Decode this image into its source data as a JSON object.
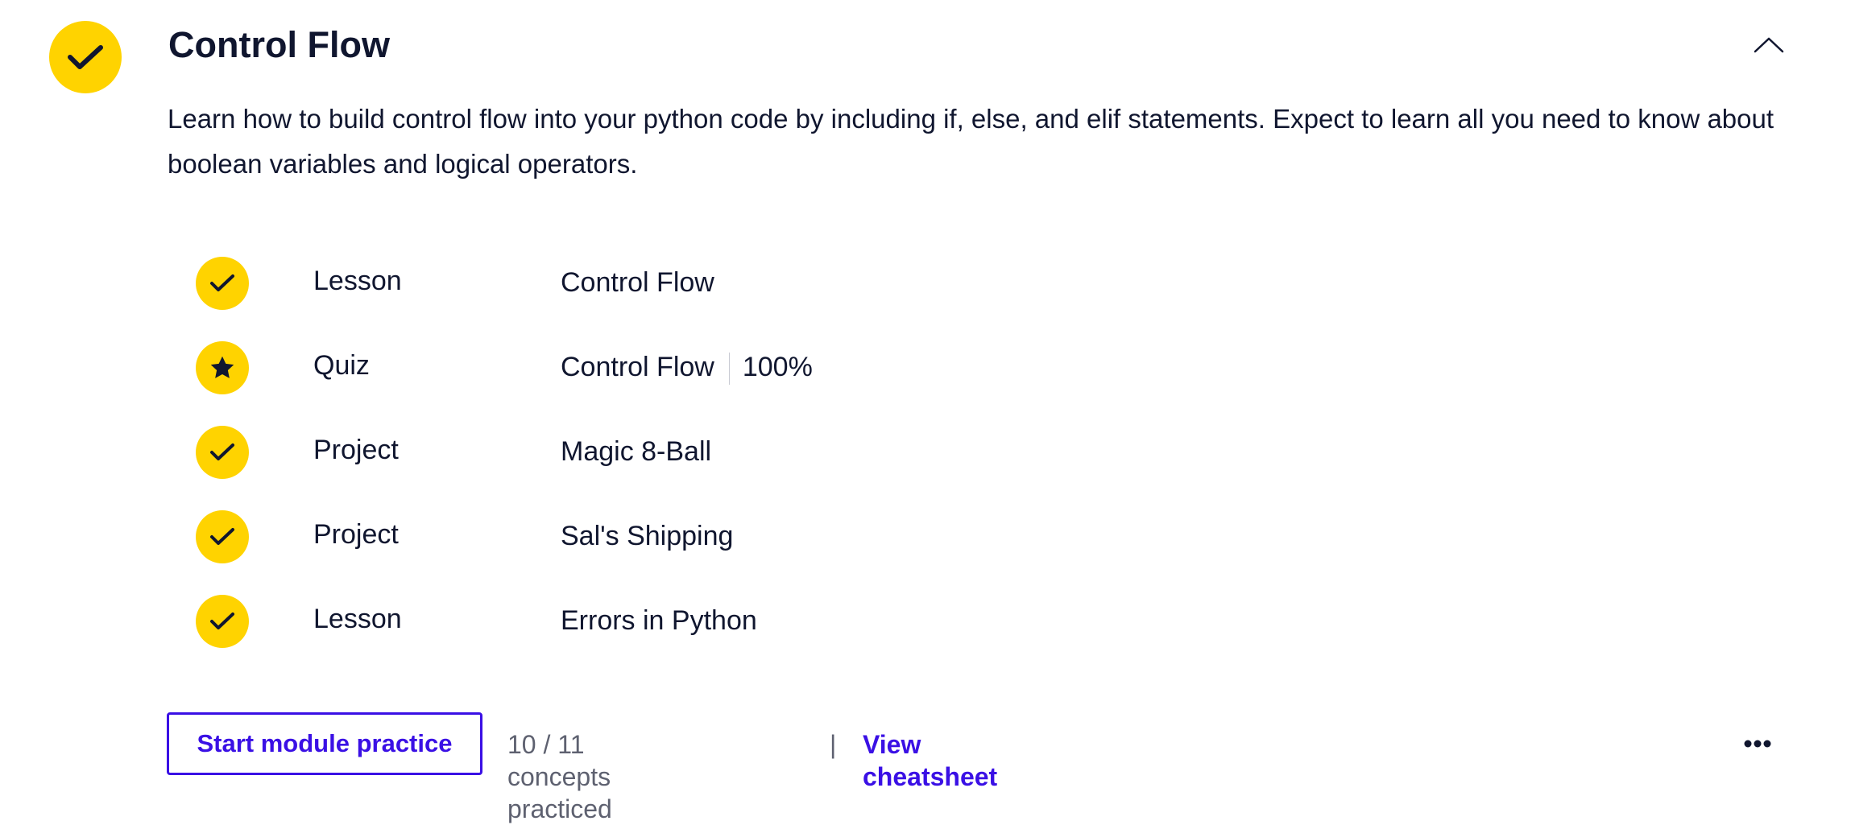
{
  "module": {
    "title": "Control Flow",
    "status_icon": "check-icon",
    "accent_color": "#ffd300",
    "collapse_icon": "chevron-up-icon",
    "description": "Learn how to build control flow into your python code by including if, else, and elif statements. Expect to learn all you need to know about boolean variables and logical operators."
  },
  "items": [
    {
      "type": "Lesson",
      "name": "Control Flow",
      "icon": "check-icon",
      "score": null
    },
    {
      "type": "Quiz",
      "name": "Control Flow",
      "icon": "star-icon",
      "score": "100%"
    },
    {
      "type": "Project",
      "name": "Magic 8-Ball",
      "icon": "check-icon",
      "score": null
    },
    {
      "type": "Project",
      "name": "Sal's Shipping",
      "icon": "check-icon",
      "score": null
    },
    {
      "type": "Lesson",
      "name": "Errors in Python",
      "icon": "check-icon",
      "score": null
    }
  ],
  "footer": {
    "practice_button": "Start module practice",
    "concepts_text": "10 / 11 concepts practiced",
    "separator": "|",
    "cheatsheet_link": "View cheatsheet",
    "more_icon": "more-horizontal-icon",
    "link_color": "#3a10e5"
  }
}
